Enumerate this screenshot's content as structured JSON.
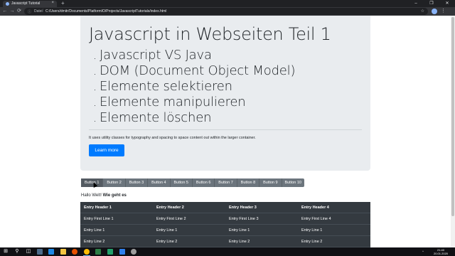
{
  "browser": {
    "tab_title": "Javascript Tutorial",
    "tab_close": "×",
    "new_tab": "+",
    "window_controls": [
      "–",
      "❐",
      "✕"
    ],
    "nav": {
      "back": "←",
      "forward": "→",
      "reload": "⟳"
    },
    "address": {
      "info": "ⓘ",
      "scheme": "Datei",
      "separator": "|",
      "url": "C:/Users/dmitr/Documents/PlatformIO/Projects/JavascriptTutorials/index.html",
      "star": "☆"
    },
    "menu": "⋮"
  },
  "page": {
    "jumbotron": {
      "title": "Javascript in Webseiten Teil 1",
      "items": [
        "Javascript VS Java",
        "DOM (Document Object Model)",
        "Elemente selektieren",
        "Elemente manipulieren",
        "Elemente löschen"
      ],
      "bullet": ".",
      "lead": "It uses utility classes for typography and spacing to space content out within the larger container.",
      "button_label": "Learn more",
      "accent": "#007bff"
    },
    "button_group": [
      "Button 1",
      "Button 2",
      "Button 3",
      "Button 4",
      "Button 5",
      "Button 6",
      "Button 7",
      "Button 8",
      "Button 9",
      "Button 10"
    ],
    "greeting": {
      "plain": "Hallo Welt!",
      "bold": "Wie geht es"
    },
    "table": {
      "headers": [
        "Entry Header 1",
        "Entry Header 2",
        "Entry Header 3",
        "Entry Header 4"
      ],
      "rows": [
        [
          "Entry First Line 1",
          "Entry First Line 2",
          "Entry First Line 3",
          "Entry First Line 4"
        ],
        [
          "Entry Line 1",
          "Entry Line 1",
          "Entry Line 1",
          "Entry Line 1"
        ],
        [
          "Entry Line 2",
          "Entry Line 2",
          "Entry Line 2",
          "Entry Line 2"
        ]
      ]
    }
  },
  "taskbar": {
    "start": "⊞",
    "search": "⚲",
    "taskview": "◫",
    "tray_time": "21:40",
    "tray_date": "20.01.2020",
    "tray_up": "^"
  }
}
